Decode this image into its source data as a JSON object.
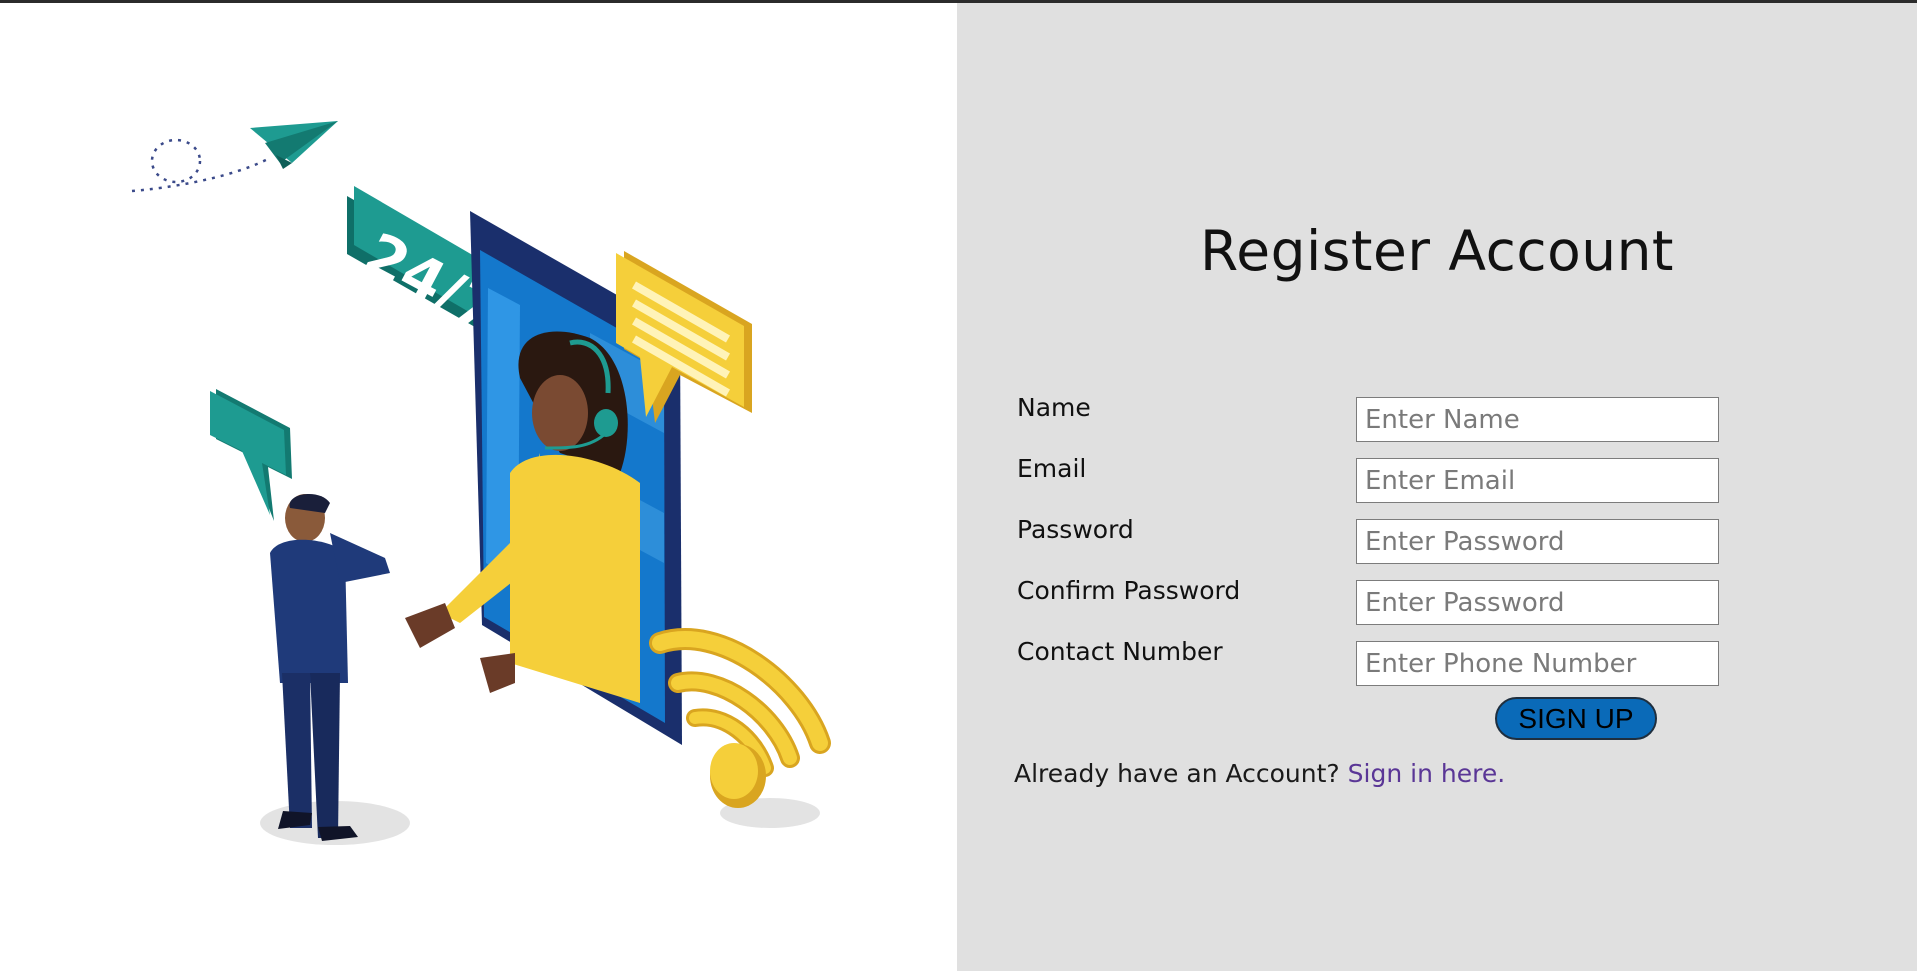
{
  "page": {
    "title": "Register Account"
  },
  "illustration": {
    "badge_text": "24/7"
  },
  "form": {
    "fields": [
      {
        "label": "Name",
        "placeholder": "Enter Name"
      },
      {
        "label": "Email",
        "placeholder": "Enter Email"
      },
      {
        "label": "Password",
        "placeholder": "Enter Password"
      },
      {
        "label": "Confirm Password",
        "placeholder": "Enter Password"
      },
      {
        "label": "Contact Number",
        "placeholder": "Enter Phone Number"
      }
    ],
    "submit_label": "SIGN UP",
    "signin_prompt": "Already have an Account?",
    "signin_link": "Sign in here."
  },
  "colors": {
    "right_panel_bg": "#e0e0e0",
    "button_bg": "#0a6ab8",
    "link": "#5a3696",
    "accent_teal": "#1e9b91",
    "accent_yellow": "#f5cf3a",
    "phone_blue": "#1e3e8c"
  }
}
